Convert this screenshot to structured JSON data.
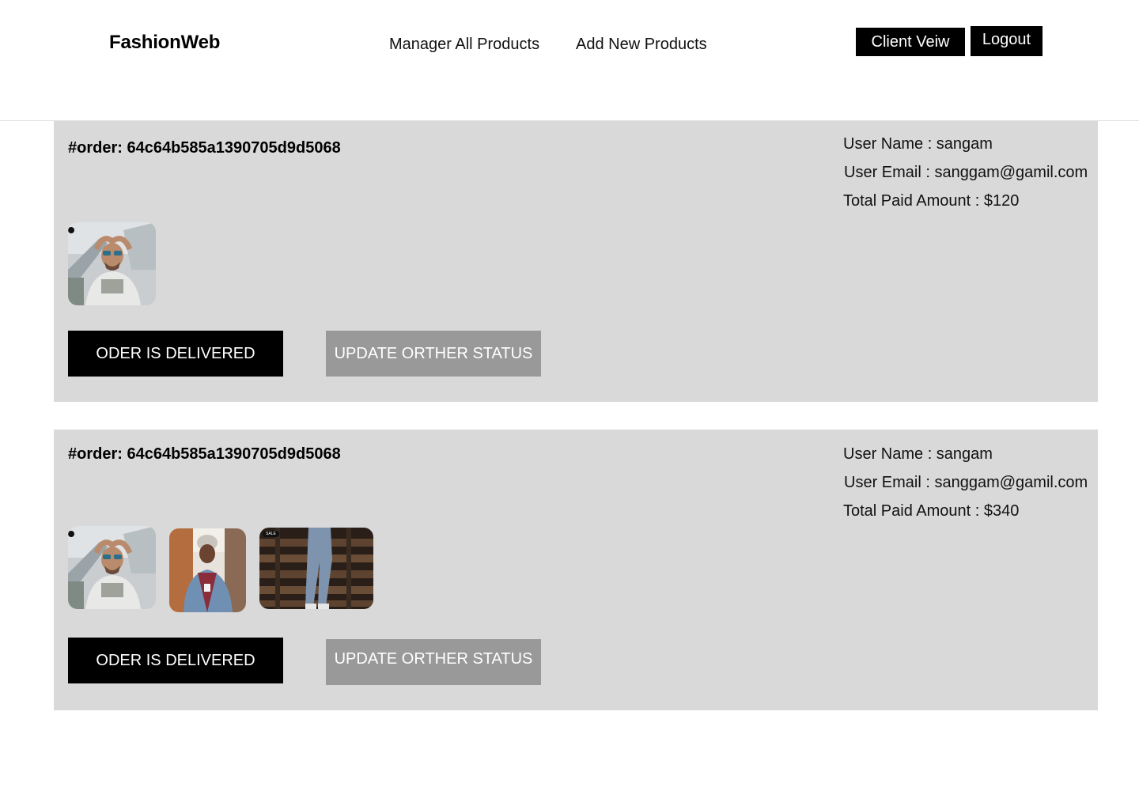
{
  "header": {
    "brand": "FashionWeb",
    "nav": {
      "manage": "Manager All Products",
      "add": "Add New Products"
    },
    "client_view": "Client Veiw",
    "logout": "Logout"
  },
  "orders": [
    {
      "id_label": "#order: 64c64b585a1390705d9d5068",
      "user_name": "User Name : sangam",
      "user_email": "User Email : sanggam@gamil.com",
      "total": "Total Paid Amount : $120",
      "images": [
        "man-sunglasses-photo"
      ],
      "delivered_label": "ODER IS DELIVERED",
      "update_label": "UPDATE ORTHER STATUS"
    },
    {
      "id_label": "#order: 64c64b585a1390705d9d5068",
      "user_name": "User Name : sangam",
      "user_email": "User Email : sanggam@gamil.com",
      "total": "Total Paid Amount : $340",
      "images": [
        "man-sunglasses-photo",
        "man-denim-jacket-photo",
        "jeans-pallets-photo"
      ],
      "sale_tag": "SALE",
      "delivered_label": "ODER IS DELIVERED",
      "update_label": "UPDATE ORTHER STATUS"
    }
  ],
  "colors": {
    "card_bg": "#d9d9d9",
    "primary_button": "#000000",
    "secondary_button": "#999999"
  }
}
